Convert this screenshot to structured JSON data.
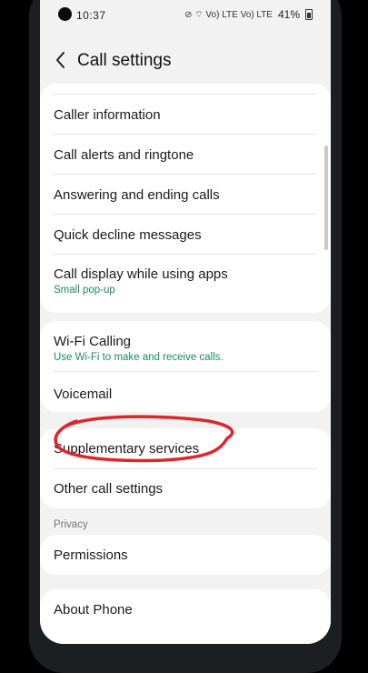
{
  "status_bar": {
    "time": "10:37",
    "status_icons": "⊘  ⌔  Vo) LTE  Vo) LTE",
    "battery": "41%"
  },
  "header": {
    "title": "Call settings"
  },
  "section1": {
    "items": [
      {
        "label": "Caller information"
      },
      {
        "label": "Call alerts and ringtone"
      },
      {
        "label": "Answering and ending calls"
      },
      {
        "label": "Quick decline messages"
      },
      {
        "label": "Call display while using apps",
        "sub": "Small pop-up"
      }
    ]
  },
  "section2": {
    "items": [
      {
        "label": "Wi-Fi Calling",
        "sub": "Use Wi-Fi to make and receive calls."
      },
      {
        "label": "Voicemail"
      }
    ]
  },
  "section3": {
    "items": [
      {
        "label": "Supplementary services"
      },
      {
        "label": "Other call settings"
      }
    ]
  },
  "privacy": {
    "section_label": "Privacy",
    "items": [
      {
        "label": "Permissions"
      }
    ]
  },
  "about": {
    "label": "About Phone"
  },
  "colors": {
    "accent": "#1a8a64",
    "annotation": "#e0242c"
  }
}
